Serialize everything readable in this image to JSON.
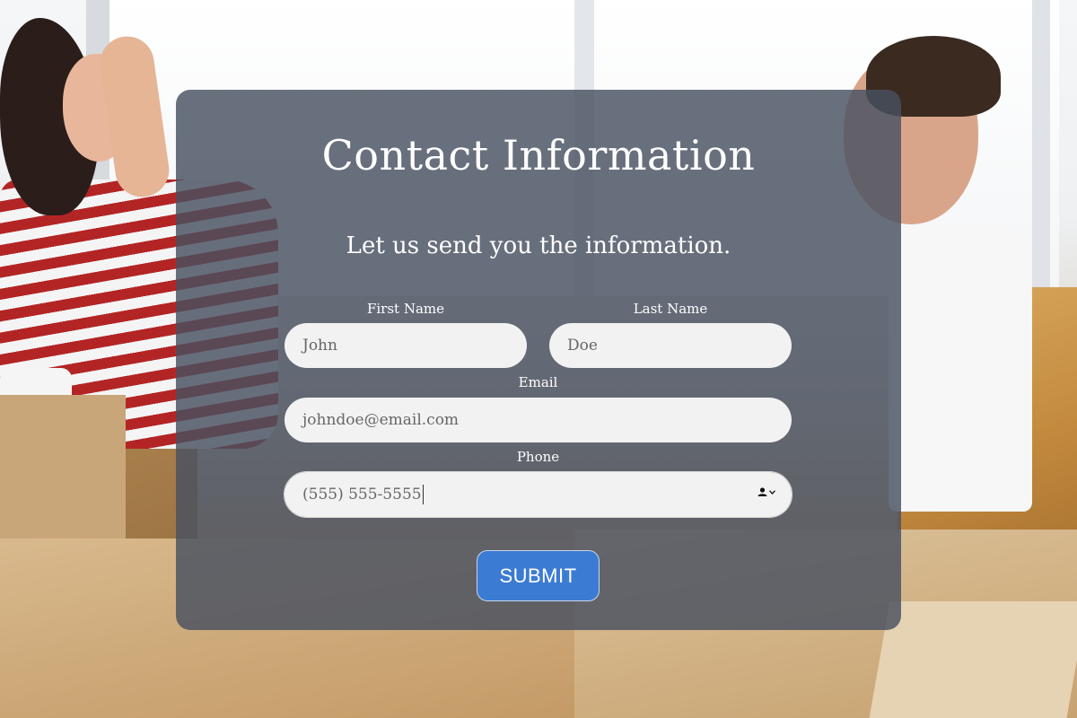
{
  "form": {
    "title": "Contact Information",
    "subtitle": "Let us send you the information.",
    "first_name": {
      "label": "First Name",
      "value": "John"
    },
    "last_name": {
      "label": "Last Name",
      "value": "Doe"
    },
    "email": {
      "label": "Email",
      "value": "johndoe@email.com"
    },
    "phone": {
      "label": "Phone",
      "value": "(555) 555-5555",
      "autofill_icon": "contact-card-icon"
    },
    "submit_label": "SUBMIT"
  },
  "colors": {
    "overlay": "#485060",
    "submit": "#3b7bd3",
    "input_bg": "#f2f2f2",
    "text_light": "#ffffff"
  },
  "background": {
    "photo_icon": "moving-couple-photo"
  }
}
